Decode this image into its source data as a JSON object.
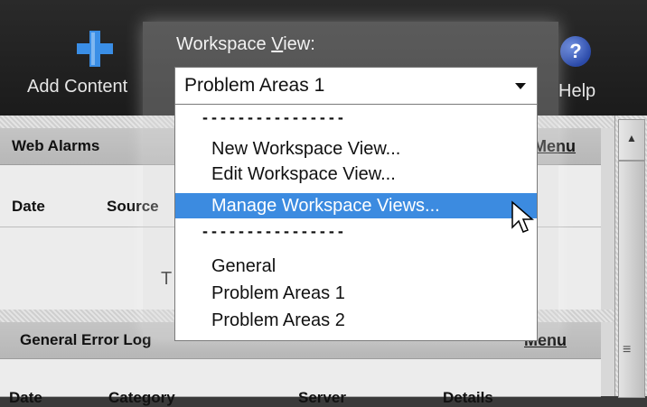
{
  "toolbar": {
    "add_content_label": "Add Content",
    "help_label": "Help",
    "help_icon": "?"
  },
  "workspace_view": {
    "label_prefix": "Workspace ",
    "label_mnemonic": "V",
    "label_suffix": "iew:",
    "selected_value": "Problem Areas 1",
    "separator": "----------------",
    "actions": [
      {
        "label": "New Workspace View..."
      },
      {
        "label": "Edit Workspace View..."
      },
      {
        "label": "Manage Workspace Views...",
        "highlighted": true
      }
    ],
    "views": [
      {
        "label": "General"
      },
      {
        "label": "Problem Areas 1"
      },
      {
        "label": "Problem Areas 2"
      }
    ]
  },
  "panels": {
    "web_alarms": {
      "title": "Web Alarms",
      "menu": "Menu",
      "columns": [
        "Date",
        "Source"
      ],
      "partial_text": "T"
    },
    "general_error_log": {
      "title": "General Error Log",
      "menu": "Menu",
      "columns": [
        "Date",
        "Category",
        "Server",
        "Details"
      ]
    }
  },
  "colors": {
    "toolbar_bg": "#1b1b1b",
    "highlight": "#3c8be0",
    "plus_icon": "#3a8ee6",
    "help_icon": "#2b4aa8"
  }
}
